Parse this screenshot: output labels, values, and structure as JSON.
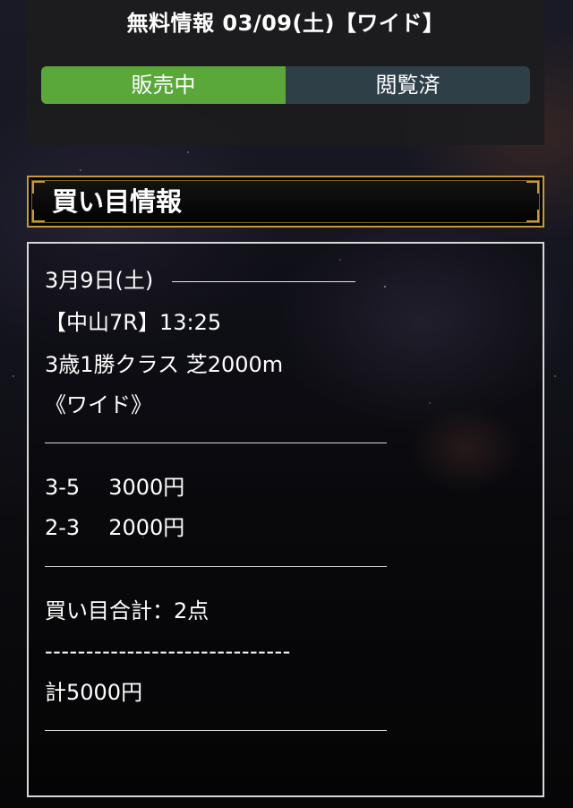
{
  "header": {
    "title": "無料情報 03/09(土)【ワイド】",
    "tabs": [
      {
        "label": "販売中",
        "color": "#5aa73a"
      },
      {
        "label": "閲覧済",
        "color": "#2f3f48"
      }
    ]
  },
  "section": {
    "title": "買い目情報"
  },
  "content": {
    "date": "3月9日(土)",
    "race": "【中山7R】13:25",
    "race_class": "3歳1勝クラス 芝2000m",
    "bet_type": "《ワイド》",
    "bets": [
      {
        "combo": "3-5",
        "amount": "3000円"
      },
      {
        "combo": "2-3",
        "amount": "2000円"
      }
    ],
    "total_points": "買い目合計：2点",
    "dash_line": "------------------------------",
    "total_amount": "計5000円"
  },
  "colors": {
    "accent_gold": "#c49a3c",
    "onsale_green": "#5aa73a",
    "viewed_slate": "#2f3f48"
  }
}
